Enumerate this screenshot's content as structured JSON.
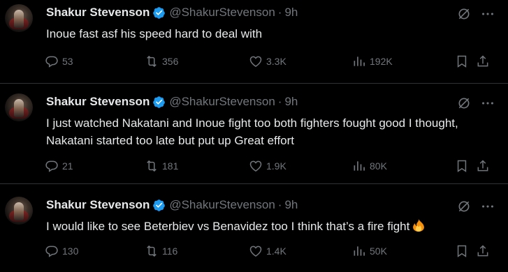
{
  "tweets": [
    {
      "author_name": "Shakur Stevenson",
      "handle": "@ShakurStevenson",
      "separator": "·",
      "time": "9h",
      "text": "Inoue fast asf his speed hard to deal with",
      "emoji": "",
      "replies": "53",
      "reposts": "356",
      "likes": "3.3K",
      "views": "192K"
    },
    {
      "author_name": "Shakur Stevenson",
      "handle": "@ShakurStevenson",
      "separator": "·",
      "time": "9h",
      "text": "I just watched Nakatani and Inoue fight too both fighters fought good I thought, Nakatani started too late but put up Great effort",
      "emoji": "",
      "replies": "21",
      "reposts": "181",
      "likes": "1.9K",
      "views": "80K"
    },
    {
      "author_name": "Shakur Stevenson",
      "handle": "@ShakurStevenson",
      "separator": "·",
      "time": "9h",
      "text": "I would like to see Beterbiev vs Benavidez too I think that’s a fire fight",
      "emoji": "fire",
      "replies": "130",
      "reposts": "116",
      "likes": "1.4K",
      "views": "50K"
    }
  ],
  "colors": {
    "background": "#000000",
    "text": "#e7e9ea",
    "secondary": "#71767b",
    "verified": "#1d9bf0",
    "divider": "#2f3336"
  }
}
